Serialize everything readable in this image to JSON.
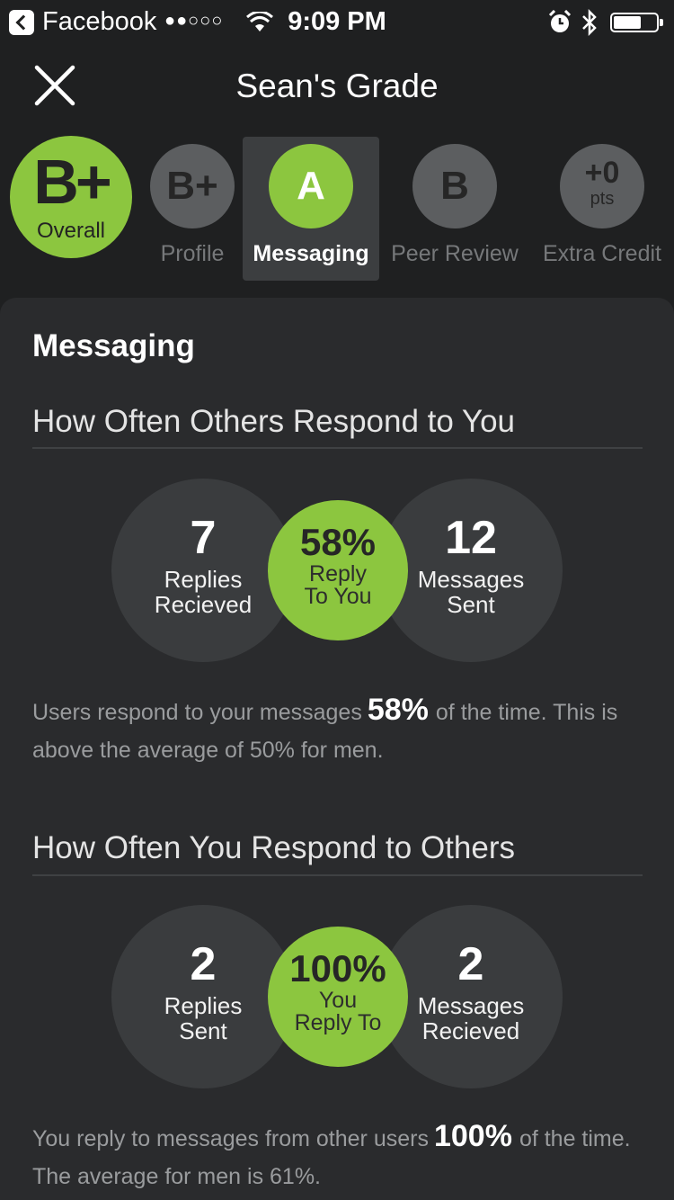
{
  "status_bar": {
    "app_name": "Facebook",
    "signal": "●●○○○",
    "time": "9:09 PM",
    "battery_level": 0.65
  },
  "header": {
    "title": "Sean's Grade"
  },
  "grades": {
    "overall": {
      "grade": "B+",
      "label": "Overall"
    },
    "tabs": [
      {
        "grade": "B+",
        "label": "Profile",
        "active": false
      },
      {
        "grade": "A",
        "label": "Messaging",
        "active": true
      },
      {
        "grade": "B",
        "label": "Peer Review",
        "active": false
      },
      {
        "grade_num": "+0",
        "grade_unit": "pts",
        "label": "Extra Credit",
        "active": false
      }
    ]
  },
  "main": {
    "title": "Messaging",
    "sections": [
      {
        "title": "How Often Others Respond to You",
        "left": {
          "value": "7",
          "line1": "Replies",
          "line2": "Recieved"
        },
        "center": {
          "value": "58%",
          "line1": "Reply",
          "line2": "To You"
        },
        "right": {
          "value": "12",
          "line1": "Messages",
          "line2": "Sent"
        },
        "desc_before": "Users respond to your messages",
        "desc_value": "58%",
        "desc_after": "of the time. This is above the average of 50% for men."
      },
      {
        "title": "How Often You Respond to Others",
        "left": {
          "value": "2",
          "line1": "Replies",
          "line2": "Sent"
        },
        "center": {
          "value": "100%",
          "line1": "You",
          "line2": "Reply To"
        },
        "right": {
          "value": "2",
          "line1": "Messages",
          "line2": "Recieved"
        },
        "desc_before": "You reply to messages from other users",
        "desc_value": "100%",
        "desc_after": "of the time. The average for men is 61%."
      }
    ]
  },
  "colors": {
    "accent": "#8cc63f",
    "background": "#1f2021",
    "card": "#2a2b2d",
    "bubble": "#3a3c3e"
  }
}
